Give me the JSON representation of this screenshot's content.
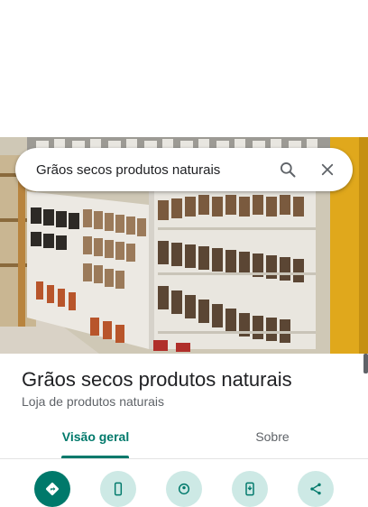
{
  "search": {
    "query": "Grãos secos produtos naturais"
  },
  "place": {
    "name": "Grãos secos produtos naturais",
    "category": "Loja de produtos naturais"
  },
  "tabs": [
    {
      "label": "Visão geral",
      "active": true
    },
    {
      "label": "Sobre",
      "active": false
    }
  ],
  "actions": [
    {
      "icon": "directions-icon"
    },
    {
      "icon": "phone-icon"
    },
    {
      "icon": "nearby-icon"
    },
    {
      "icon": "send-to-phone-icon"
    },
    {
      "icon": "share-icon"
    }
  ],
  "colors": {
    "accent": "#00796b",
    "accent_light": "#cde9e5",
    "text_primary": "#202124",
    "text_secondary": "#5f6368"
  }
}
